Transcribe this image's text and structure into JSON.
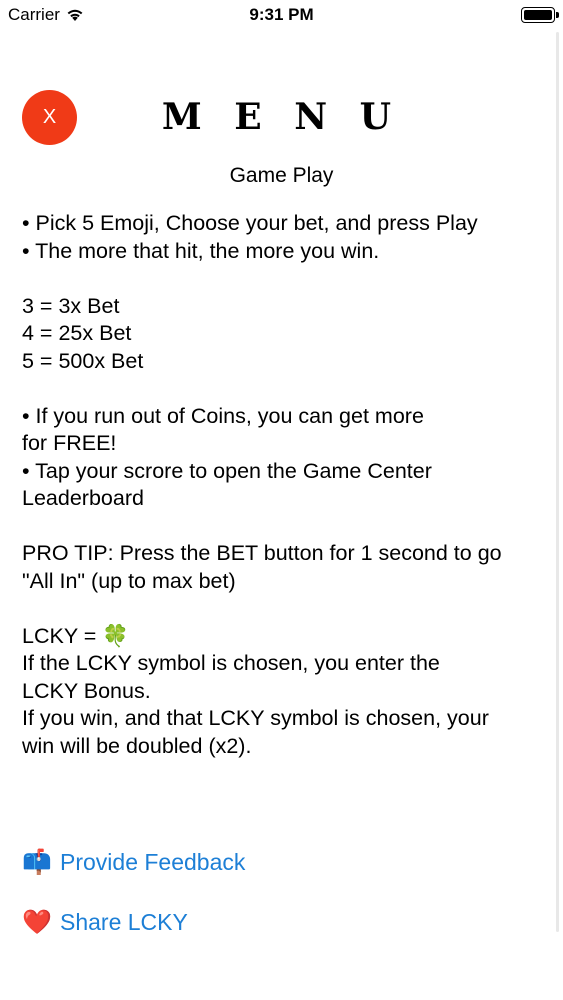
{
  "status_bar": {
    "carrier": "Carrier",
    "time": "9:31 PM"
  },
  "header": {
    "close_label": "X",
    "title": "M E N U",
    "subtitle": "Game Play"
  },
  "instructions": {
    "line1": "• Pick 5 Emoji, Choose your bet, and press Play",
    "line2": "• The more that hit, the more you win.",
    "payout1": "3 = 3x Bet",
    "payout2": "4 = 25x Bet",
    "payout3": "5 = 500x Bet",
    "coins_line1": "• If you run out of Coins, you can get more",
    "coins_line2": "for FREE!",
    "tap_line1": "• Tap your scrore to open the Game Center",
    "tap_line2": "Leaderboard",
    "tip_line1": "PRO TIP: Press the BET button for 1 second to go",
    "tip_line2": "\"All In\" (up to max bet)",
    "lcky_eq": "LCKY = ",
    "lcky_emoji": "🍀",
    "bonus_line1": "If the LCKY symbol is chosen, you enter the",
    "bonus_line2": "LCKY Bonus.",
    "double_line1": "If you win, and that LCKY symbol is chosen, your",
    "double_line2": "win will be doubled (x2)."
  },
  "links": {
    "feedback_emoji": "📫",
    "feedback_label": "Provide Feedback",
    "share_emoji": "❤️",
    "share_label": "Share LCKY",
    "color": "#1d7fd6"
  },
  "colors": {
    "close_button": "#f03a17"
  }
}
